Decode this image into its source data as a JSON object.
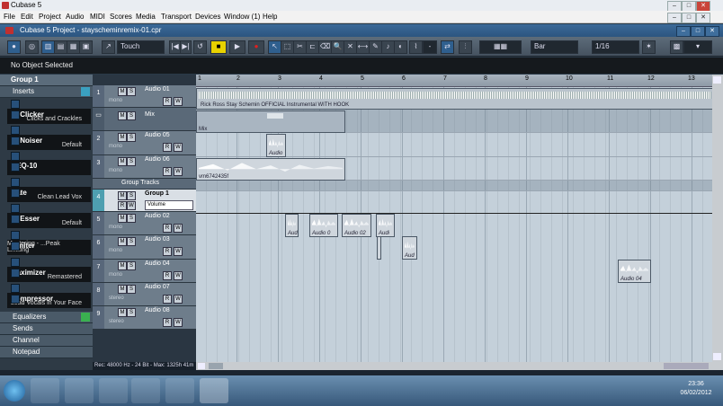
{
  "app_title": "Cubase 5",
  "window_buttons": [
    "–",
    "□",
    "✕"
  ],
  "menu": [
    "File",
    "Edit",
    "Project",
    "Audio",
    "MIDI",
    "Scores",
    "Media",
    "Transport",
    "Devices",
    "Window (1)",
    "Help"
  ],
  "project_title": "Cubase 5 Project - stayscheminremix-01.cpr",
  "toolbar": {
    "touch_label": "Touch",
    "grid_label": "Bar",
    "quantize_label": "1/16"
  },
  "info_line": "No Object Selected",
  "inspector": {
    "track_name": "Group 1",
    "inserts_label": "Inserts",
    "plugins": [
      {
        "name": "DeClicker",
        "preset": "Clicks and Crackles"
      },
      {
        "name": "DeNoiser",
        "preset": "Default"
      },
      {
        "name": "GEQ-10",
        "preset": ""
      },
      {
        "name": "Gate",
        "preset": "Clean Lead Vox"
      },
      {
        "name": "DeEsser",
        "preset": "Default"
      },
      {
        "name": "Limiter",
        "preset": "Mastering - ...Peak Limiting"
      },
      {
        "name": "Maximizer",
        "preset": "Remastered"
      },
      {
        "name": "Compressor",
        "preset": "Lead Vocals in Your Face"
      }
    ],
    "sections": [
      "Equalizers",
      "Sends",
      "Channel",
      "Notepad"
    ]
  },
  "tracks": [
    {
      "num": "1",
      "name": "Audio 01",
      "sub": "mono"
    },
    {
      "num": "",
      "name": "Mix",
      "sub": ""
    },
    {
      "num": "2",
      "name": "Audio 05",
      "sub": "mono"
    },
    {
      "num": "3",
      "name": "Audio 06",
      "sub": "mono"
    },
    {
      "num": "",
      "name": "Group Tracks",
      "sub": ""
    },
    {
      "num": "4",
      "name": "Group 1",
      "sub": "Volume"
    },
    {
      "num": "5",
      "name": "Audio 02",
      "sub": "mono"
    },
    {
      "num": "6",
      "name": "Audio 03",
      "sub": "mono"
    },
    {
      "num": "7",
      "name": "Audio 04",
      "sub": "mono"
    },
    {
      "num": "8",
      "name": "Audio 07",
      "sub": "stereo"
    },
    {
      "num": "9",
      "name": "Audio 08",
      "sub": "stereo"
    }
  ],
  "ruler": [
    "1",
    "2",
    "3",
    "4",
    "5",
    "6",
    "7",
    "8",
    "9",
    "10",
    "11",
    "12",
    "13"
  ],
  "events": {
    "main_label": "Rick Ross Stay Schemin OFFICIAL Instrumental WITH HOOK",
    "mix_label": "Mix",
    "audio05_label": "Audio",
    "audio06_label": "vm6742435f",
    "a2_1": "Aud",
    "a2_2": "Audio 0",
    "a2_3": "Audio 02",
    "a2_4": "Audi",
    "a3_1": "Aud",
    "a4_1": "Audio 04"
  },
  "status": "Rec: 48000 Hz - 24 Bit - Max: 1325h 41m",
  "clock": {
    "time": "23:36",
    "date": "06/02/2012"
  }
}
